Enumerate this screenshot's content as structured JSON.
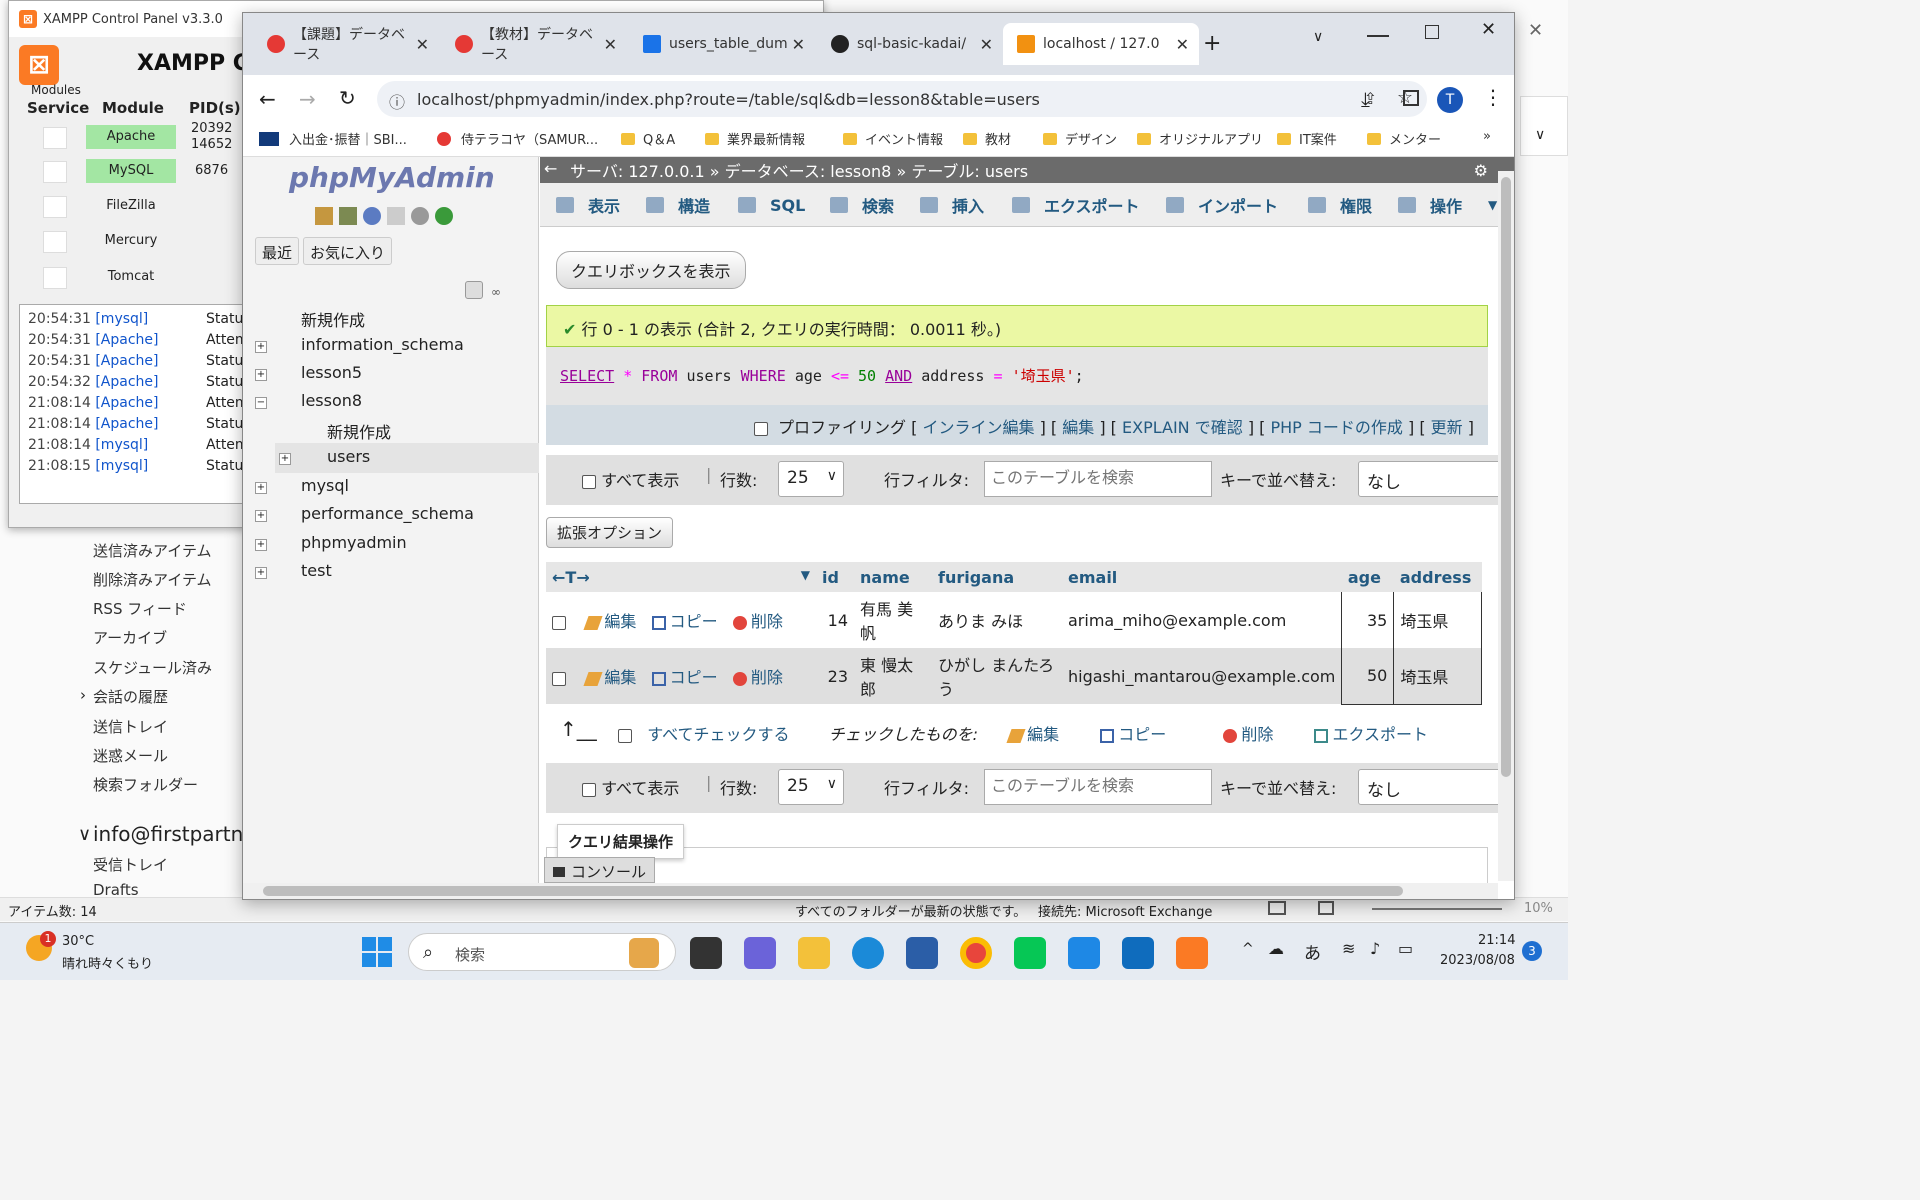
{
  "outlook": {
    "folders": [
      "送信済みアイテム",
      "削除済みアイテム",
      "RSS フィード",
      "アーカイブ",
      "スケジュール済み",
      "会話の履歴",
      "送信トレイ",
      "迷惑メール",
      "検索フォルダー"
    ],
    "account": "info@firstpartne",
    "account_folders": [
      "受信トレイ",
      "Drafts"
    ],
    "status_items": "アイテム数: 14",
    "status_sync": "すべてのフォルダーが最新の状態です。",
    "status_conn": "接続先: Microsoft Exchange",
    "zoom": "10%"
  },
  "xampp": {
    "title": "XAMPP Control Panel v3.3.0",
    "header": "XAMPP Co",
    "modules_label": "Modules",
    "col_service": "Service",
    "col_module": "Module",
    "col_pid": "PID(s)",
    "modules": [
      {
        "name": "Apache",
        "pid": "20392\n14652",
        "running": true
      },
      {
        "name": "MySQL",
        "pid": "6876",
        "running": true
      },
      {
        "name": "FileZilla",
        "pid": "",
        "running": false
      },
      {
        "name": "Mercury",
        "pid": "",
        "running": false
      },
      {
        "name": "Tomcat",
        "pid": "",
        "running": false
      }
    ],
    "log": [
      {
        "time": "20:54:31",
        "mod": "[mysql]",
        "msg": "Status"
      },
      {
        "time": "20:54:31",
        "mod": "[Apache]",
        "msg": "Attem"
      },
      {
        "time": "20:54:31",
        "mod": "[Apache]",
        "msg": "Status"
      },
      {
        "time": "20:54:32",
        "mod": "[Apache]",
        "msg": "Status"
      },
      {
        "time": "21:08:14",
        "mod": "[Apache]",
        "msg": "Attem"
      },
      {
        "time": "21:08:14",
        "mod": "[Apache]",
        "msg": "Status"
      },
      {
        "time": "21:08:14",
        "mod": "[mysql]",
        "msg": "Attem"
      },
      {
        "time": "21:08:15",
        "mod": "[mysql]",
        "msg": "Status"
      }
    ]
  },
  "chrome": {
    "tabs": [
      {
        "label": "【課題】データベース",
        "color": "#e53935"
      },
      {
        "label": "【教材】データベース",
        "color": "#e53935"
      },
      {
        "label": "users_table_dum",
        "color": "#1a73e8"
      },
      {
        "label": "sql-basic-kadai/",
        "color": "#222222"
      },
      {
        "label": "localhost / 127.0",
        "color": "#f29111"
      }
    ],
    "url": "localhost/phpmyadmin/index.php?route=/table/sql&db=lesson8&table=users",
    "profile": "T",
    "bookmarks": [
      "入出金･振替｜SBI...",
      "侍テラコヤ（SAMUR...",
      "Q＆A",
      "業界最新情報",
      "イベント情報",
      "教材",
      "デザイン",
      "オリジナルアプリ",
      "IT案件",
      "メンター"
    ]
  },
  "pma": {
    "logo": "phpMyAdmin",
    "nav_recent": "最近",
    "nav_fav": "お気に入り",
    "tree": [
      {
        "label": "新規作成",
        "level": 0,
        "expand": ""
      },
      {
        "label": "information_schema",
        "level": 0,
        "expand": "+"
      },
      {
        "label": "lesson5",
        "level": 0,
        "expand": "+"
      },
      {
        "label": "lesson8",
        "level": 0,
        "expand": "−"
      },
      {
        "label": "新規作成",
        "level": 1,
        "expand": ""
      },
      {
        "label": "users",
        "level": 1,
        "expand": "+"
      },
      {
        "label": "mysql",
        "level": 0,
        "expand": "+"
      },
      {
        "label": "performance_schema",
        "level": 0,
        "expand": "+"
      },
      {
        "label": "phpmyadmin",
        "level": 0,
        "expand": "+"
      },
      {
        "label": "test",
        "level": 0,
        "expand": "+"
      }
    ],
    "breadcrumb": "サーバ: 127.0.0.1 » データベース: lesson8 » テーブル: users",
    "menu": [
      "表示",
      "構造",
      "SQL",
      "検索",
      "挿入",
      "エクスポート",
      "インポート",
      "権限",
      "操作"
    ],
    "show_query_box": "クエリボックスを表示",
    "success": "行 0 - 1 の表示 (合計 2, クエリの実行時間： 0.0011 秒。)",
    "sql": {
      "select": "SELECT",
      "star": "*",
      "from": "FROM",
      "table": "users",
      "where": "WHERE",
      "col1": "age",
      "op1": "<=",
      "val1": "50",
      "and": "AND",
      "col2": "address",
      "op2": "=",
      "val2": "'埼玉県'",
      "end": ";"
    },
    "profiling": "プロファイリング",
    "links": [
      "インライン編集",
      "編集",
      "EXPLAIN で確認",
      "PHP コードの作成",
      "更新"
    ],
    "show_all": "すべて表示",
    "rows_label": "行数:",
    "rows_value": "25",
    "filter_label": "行フィルタ:",
    "filter_placeholder": "このテーブルを検索",
    "sort_label": "キーで並べ替え:",
    "sort_value": "なし",
    "extended": "拡張オプション",
    "columns": [
      "id",
      "name",
      "furigana",
      "email",
      "age",
      "address"
    ],
    "actions": {
      "edit": "編集",
      "copy": "コピー",
      "delete": "削除"
    },
    "rows": [
      {
        "id": "14",
        "name": "有馬 美帆",
        "furigana": "ありま みほ",
        "email": "arima_miho@example.com",
        "age": "35",
        "address": "埼玉県"
      },
      {
        "id": "23",
        "name": "東 慢太郎",
        "furigana": "ひがし まんたろう",
        "email": "higashi_mantarou@example.com",
        "age": "50",
        "address": "埼玉県"
      }
    ],
    "check_all": "すべてチェックする",
    "with_selected": "チェックしたものを:",
    "bulk": [
      "編集",
      "コピー",
      "削除",
      "エクスポート"
    ],
    "query_ops": "クエリ結果操作",
    "console": "コンソール"
  },
  "taskbar": {
    "weather_temp": "30°C",
    "weather_desc": "晴れ時々くもり",
    "weather_badge": "1",
    "search": "検索",
    "ime": "あ",
    "time": "21:14",
    "date": "2023/08/08",
    "notif": "3"
  }
}
